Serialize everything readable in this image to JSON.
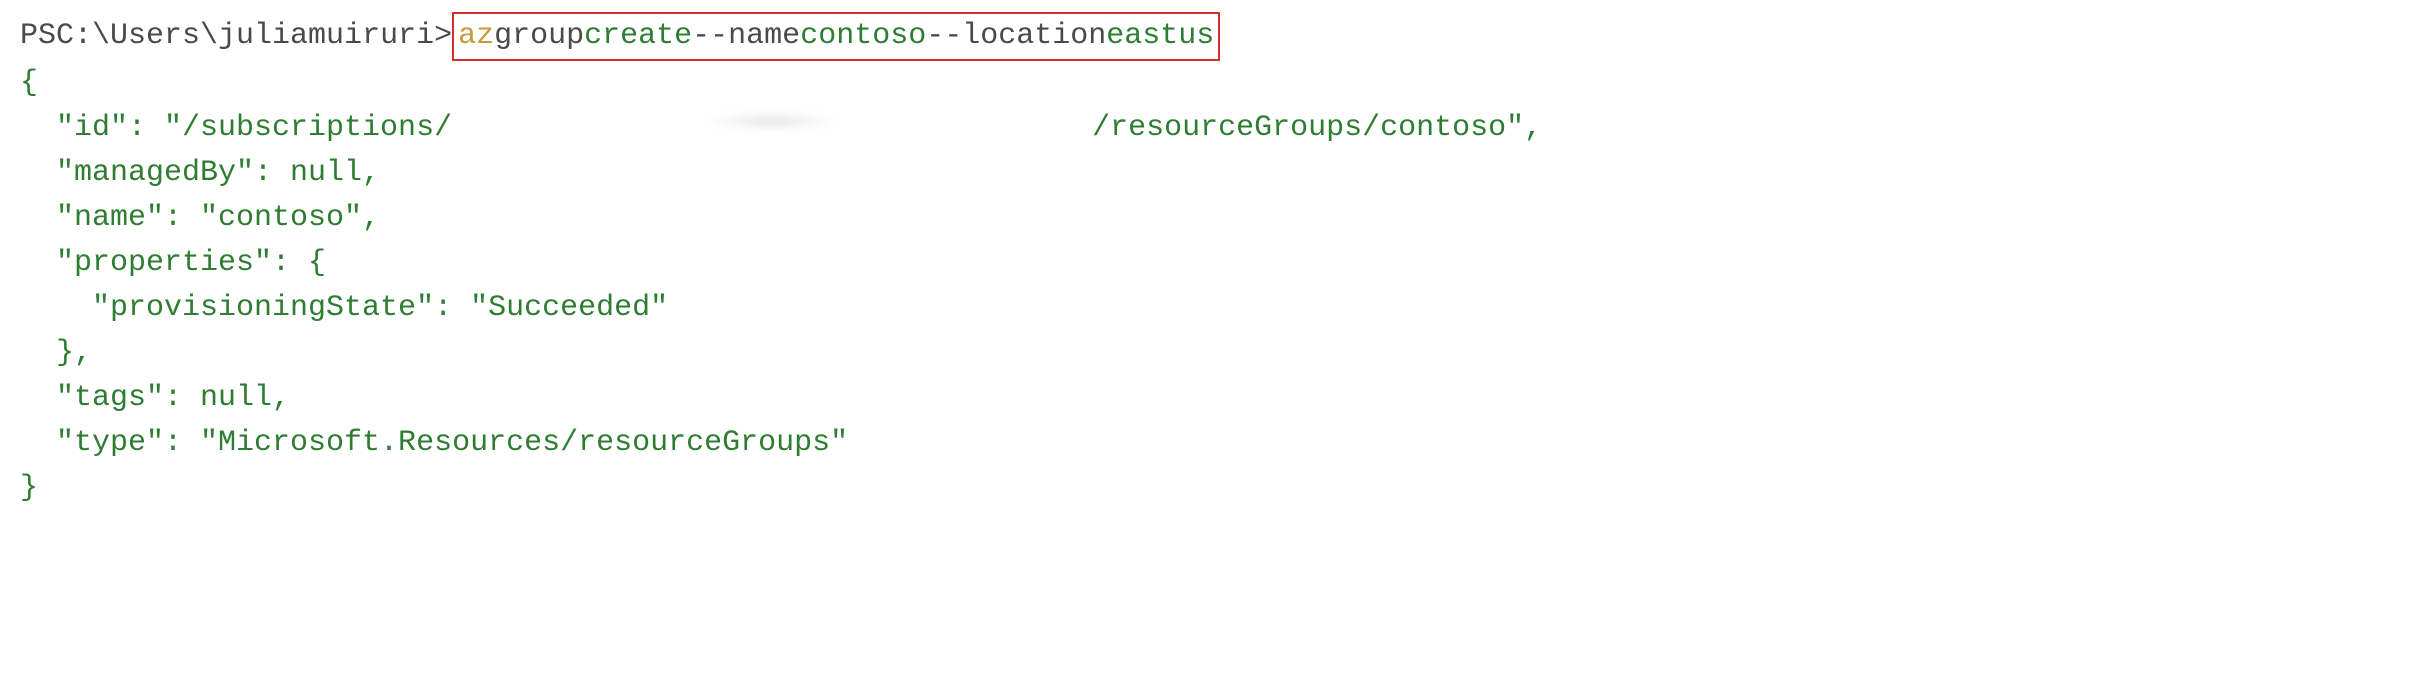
{
  "prompt": {
    "prefix": "PS ",
    "path": "C:\\Users\\juliamuiruri",
    "suffix": "> "
  },
  "command": {
    "az": "az",
    "group": " group ",
    "create": "create ",
    "flag_name": "--name ",
    "val_name": "contoso ",
    "flag_location": "--location ",
    "val_location": "eastus"
  },
  "output": {
    "brace_open": "{",
    "id_key": "  \"id\": \"/subscriptions/",
    "id_tail": "/resourceGroups/contoso\",",
    "managedBy": "  \"managedBy\": null,",
    "name": "  \"name\": \"contoso\",",
    "properties_open": "  \"properties\": {",
    "provisioningState": "    \"provisioningState\": \"Succeeded\"",
    "properties_close": "  },",
    "tags": "  \"tags\": null,",
    "type": "  \"type\": \"Microsoft.Resources/resourceGroups\"",
    "brace_close": "}"
  }
}
